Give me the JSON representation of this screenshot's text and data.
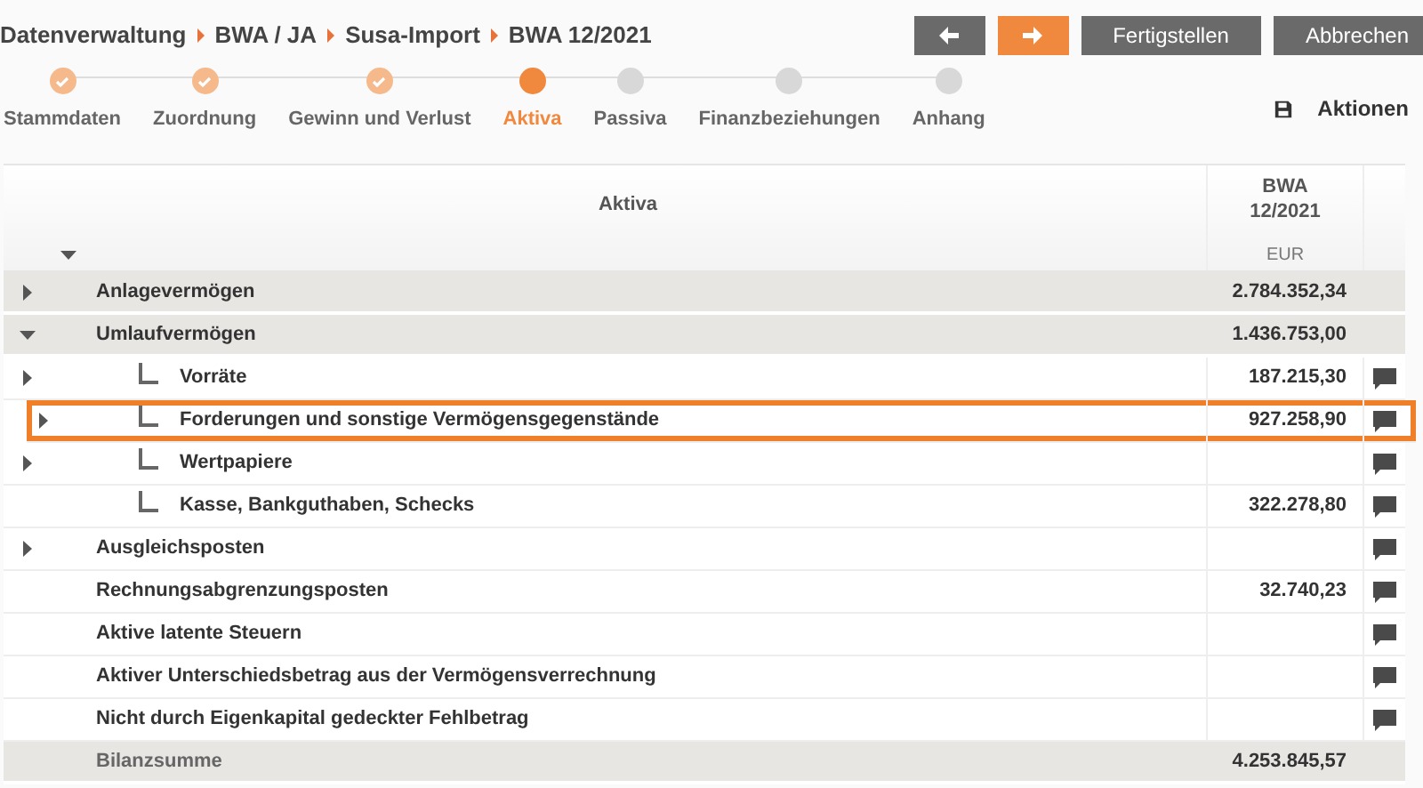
{
  "breadcrumb": [
    "Datenverwaltung",
    "BWA / JA",
    "Susa-Import",
    "BWA 12/2021"
  ],
  "buttons": [
    {
      "kind": "back"
    },
    {
      "kind": "forward"
    },
    {
      "kind": "text",
      "label": "Fertigstellen"
    },
    {
      "kind": "text",
      "label": "Abbrechen"
    }
  ],
  "steps": [
    {
      "label": "Stammdaten",
      "completed": true,
      "selected": false
    },
    {
      "label": "Zuordnung",
      "completed": true,
      "selected": false
    },
    {
      "label": "Gewinn und Verlust",
      "completed": true,
      "selected": false
    },
    {
      "label": "Aktiva",
      "completed": false,
      "selected": true
    },
    {
      "label": "Passiva",
      "completed": false,
      "selected": false
    },
    {
      "label": "Finanzbeziehungen",
      "completed": false,
      "selected": false
    },
    {
      "label": "Anhang",
      "completed": false,
      "selected": false
    }
  ],
  "actions": {
    "label": "Aktionen"
  },
  "table": {
    "columns": [
      {
        "label": "Aktiva"
      },
      {
        "label": "BWA 12/2021",
        "unit": "EUR"
      }
    ],
    "rows": [
      {
        "kind": "group",
        "label": "Anlagevermögen",
        "amount": "2.784.352,34",
        "expanded": false,
        "comment": false,
        "selected": false
      },
      {
        "kind": "group",
        "label": "Umlaufvermögen",
        "amount": "1.436.753,00",
        "expanded": true,
        "comment": false,
        "selected": false,
        "children": [
          {
            "kind": "item",
            "label": "Vorräte",
            "amount": "187.215,30",
            "expanded": false,
            "comment": true,
            "selected": false
          },
          {
            "kind": "item",
            "label": "Forderungen und sonstige Vermögensgegenstände",
            "amount": "927.258,90",
            "expanded": false,
            "comment": true,
            "selected": true
          },
          {
            "kind": "item",
            "label": "Wertpapiere",
            "expanded": false,
            "comment": true,
            "selected": false
          },
          {
            "kind": "item",
            "label": "Kasse, Bankguthaben, Schecks",
            "amount": "322.278,80",
            "comment": true,
            "selected": false
          }
        ]
      },
      {
        "kind": "item",
        "label": "Ausgleichsposten",
        "expanded": false,
        "comment": true,
        "selected": false
      },
      {
        "kind": "item",
        "label": "Rechnungsabgrenzungsposten",
        "amount": "32.740,23",
        "comment": true,
        "selected": false
      },
      {
        "kind": "item",
        "label": "Aktive latente Steuern",
        "comment": true,
        "selected": false
      },
      {
        "kind": "item",
        "label": "Aktiver Unterschiedsbetrag aus der Vermögensverrechnung",
        "comment": true,
        "selected": false
      },
      {
        "kind": "item",
        "label": "Nicht durch Eigenkapital gedeckter Fehlbetrag",
        "comment": true,
        "selected": false
      },
      {
        "kind": "total",
        "label": "Bilanzsumme",
        "amount": "4.253.845,57",
        "comment": false,
        "selected": false
      }
    ]
  }
}
